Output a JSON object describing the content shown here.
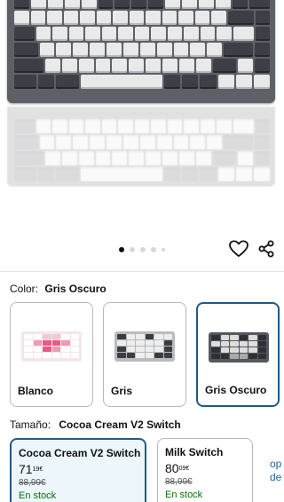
{
  "gallery": {
    "image_alt": "Teclado mecánico gris oscuro",
    "dots_total": 5,
    "dots_active": 0,
    "wishlist_icon": "heart-icon",
    "share_icon": "share-icon"
  },
  "color": {
    "label": "Color:",
    "selected": "Gris Oscuro",
    "options": [
      {
        "name": "Blanco",
        "selected": false
      },
      {
        "name": "Gris",
        "selected": false
      },
      {
        "name": "Gris Oscuro",
        "selected": true
      }
    ]
  },
  "size": {
    "label": "Tamaño:",
    "selected": "Cocoa Cream V2 Switch",
    "options": [
      {
        "name": "Cocoa Cream V2 Switch",
        "price_whole": "71",
        "price_fraction": "19",
        "currency": "€",
        "was_price": "88,99€",
        "availability": "En stock",
        "selected": true
      },
      {
        "name": "Milk Switch",
        "price_whole": "80",
        "price_fraction": "09",
        "currency": "€",
        "was_price": "88,99€",
        "availability": "En stock",
        "selected": false
      }
    ],
    "more_text_line1": "op",
    "more_text_line2": "de"
  },
  "colors": {
    "accent": "#1f5a8a",
    "in_stock": "#007600",
    "link": "#2162a1"
  }
}
